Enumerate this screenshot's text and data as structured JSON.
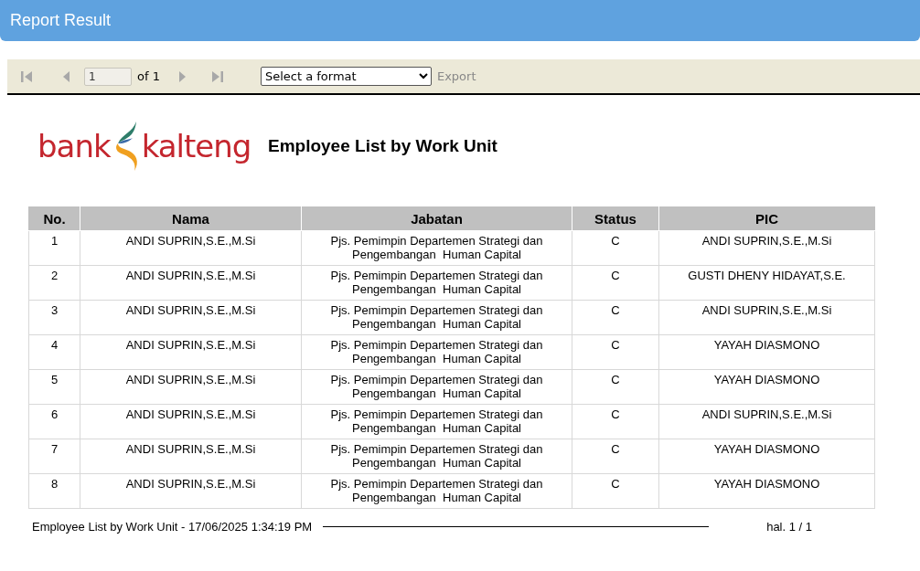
{
  "header": {
    "title": "Report Result"
  },
  "toolbar": {
    "page_value": "1",
    "page_of": "of 1",
    "format_select": "Select a format",
    "export": "Export",
    "export_disabled": true
  },
  "report": {
    "logo": {
      "word_1": "bank",
      "word_2": "kalteng"
    },
    "title": "Employee List by Work Unit",
    "table": {
      "columns": [
        "No.",
        "Nama",
        "Jabatan",
        "Status",
        "PIC"
      ],
      "rows": [
        [
          "1",
          "ANDI SUPRIN,S.E.,M.Si",
          "Pjs. Pemimpin Departemen Strategi dan Pengembangan  Human Capital",
          "C",
          "ANDI SUPRIN,S.E.,M.Si"
        ],
        [
          "2",
          "ANDI SUPRIN,S.E.,M.Si",
          "Pjs. Pemimpin Departemen Strategi dan Pengembangan  Human Capital",
          "C",
          "GUSTI DHENY HIDAYAT,S.E."
        ],
        [
          "3",
          "ANDI SUPRIN,S.E.,M.Si",
          "Pjs. Pemimpin Departemen Strategi dan Pengembangan  Human Capital",
          "C",
          "ANDI SUPRIN,S.E.,M.Si"
        ],
        [
          "4",
          "ANDI SUPRIN,S.E.,M.Si",
          "Pjs. Pemimpin Departemen Strategi dan Pengembangan  Human Capital",
          "C",
          "YAYAH DIASMONO"
        ],
        [
          "5",
          "ANDI SUPRIN,S.E.,M.Si",
          "Pjs. Pemimpin Departemen Strategi dan Pengembangan  Human Capital",
          "C",
          "YAYAH DIASMONO"
        ],
        [
          "6",
          "ANDI SUPRIN,S.E.,M.Si",
          "Pjs. Pemimpin Departemen Strategi dan Pengembangan  Human Capital",
          "C",
          "ANDI SUPRIN,S.E.,M.Si"
        ],
        [
          "7",
          "ANDI SUPRIN,S.E.,M.Si",
          "Pjs. Pemimpin Departemen Strategi dan Pengembangan  Human Capital",
          "C",
          "YAYAH DIASMONO"
        ],
        [
          "8",
          "ANDI SUPRIN,S.E.,M.Si",
          "Pjs. Pemimpin Departemen Strategi dan Pengembangan  Human Capital",
          "C",
          "YAYAH DIASMONO"
        ]
      ]
    },
    "footer": {
      "left": "Employee List by Work Unit - 17/06/2025 1:34:19 PM",
      "right": "hal. 1 / 1"
    }
  }
}
